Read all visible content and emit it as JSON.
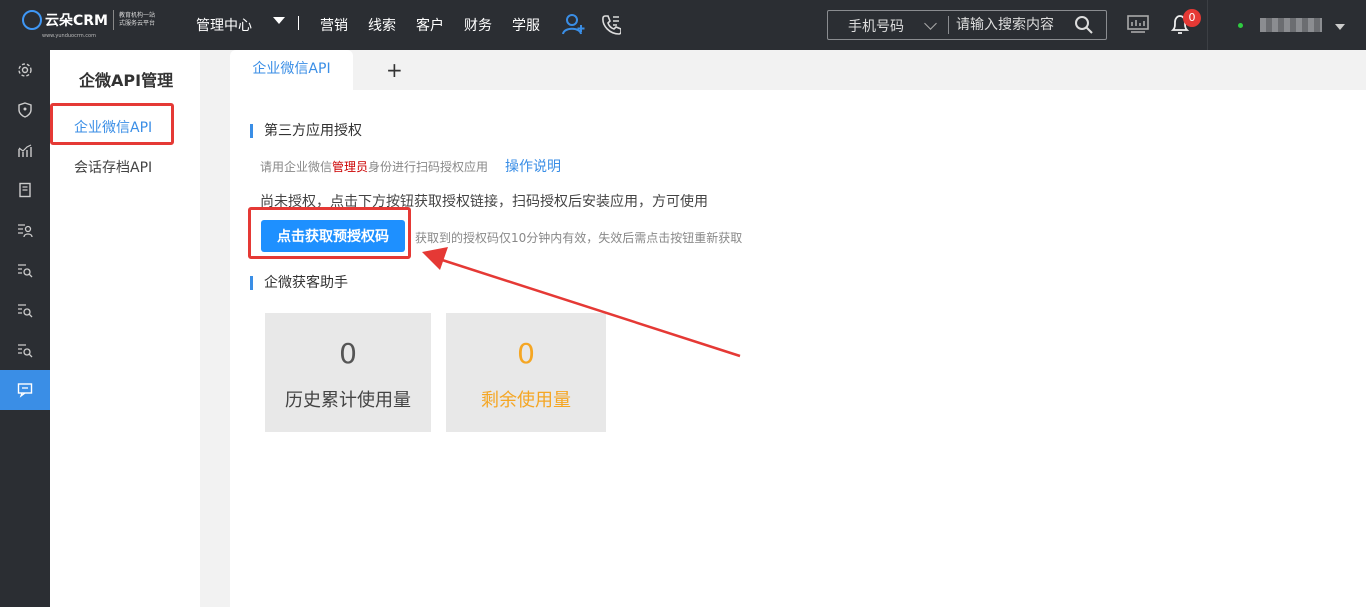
{
  "brand": {
    "name": "云朵CRM",
    "url": "www.yunduocrm.com",
    "slogan_line1": "教育机构一站",
    "slogan_line2": "式服务云平台"
  },
  "topnav": {
    "management": "管理中心",
    "items": [
      "营销",
      "线索",
      "客户",
      "财务",
      "学服"
    ]
  },
  "search": {
    "type": "手机号码",
    "placeholder": "请输入搜索内容"
  },
  "notifications": {
    "count": "0"
  },
  "sidebar": {
    "title": "企微API管理",
    "items": [
      "企业微信API",
      "会话存档API"
    ]
  },
  "tabs": {
    "active": "企业微信API",
    "add_label": "+"
  },
  "auth": {
    "section_title": "第三方应用授权",
    "hint_before": "请用企业微信",
    "hint_emphasis": "管理员",
    "hint_after": "身份进行扫码授权应用",
    "help_link": "操作说明",
    "notice": "尚未授权，点击下方按钮获取授权链接，扫码授权后安装应用，方可使用",
    "button": "点击获取预授权码",
    "button_hint": "获取到的授权码仅10分钟内有效，失效后需点击按钮重新获取"
  },
  "assistant": {
    "section_title": "企微获客助手",
    "stats": [
      {
        "value": "0",
        "label": "历史累计使用量",
        "color": "#555555"
      },
      {
        "value": "0",
        "label": "剩余使用量",
        "color": "#f5a623"
      }
    ]
  },
  "colors": {
    "accent": "#3a8ee6",
    "topbar": "#2b2e33",
    "highlight": "#e53935"
  }
}
